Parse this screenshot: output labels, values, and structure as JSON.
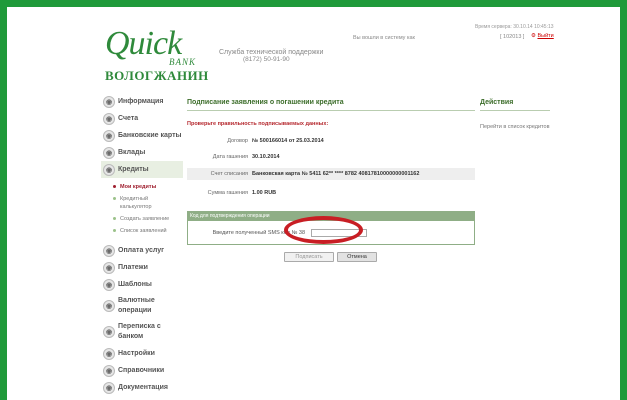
{
  "header": {
    "logo_quick": "Quick",
    "logo_bank": "BANK",
    "logo_vologzhanin": "ВОЛОГЖАНИН",
    "support_label": "Служба технической поддержки",
    "support_phone": "(8172) 50-91-90",
    "login_text": "Вы вошли в систему как",
    "session_info": "Время сервера: 30.10.14 10:45:13",
    "account": "[ 102013 ]",
    "exit_label": "Выйти"
  },
  "sidebar": {
    "items": [
      {
        "label": "Информация"
      },
      {
        "label": "Счета"
      },
      {
        "label": "Банковские карты"
      },
      {
        "label": "Вклады"
      },
      {
        "label": "Кредиты"
      },
      {
        "label": "Оплата услуг"
      },
      {
        "label": "Платежи"
      },
      {
        "label": "Шаблоны"
      },
      {
        "label": "Валютные операции"
      },
      {
        "label": "Переписка с банком"
      },
      {
        "label": "Настройки"
      },
      {
        "label": "Справочники"
      },
      {
        "label": "Документация"
      }
    ],
    "credit_subitems": [
      {
        "label": "Мои кредиты"
      },
      {
        "label": "Кредитный калькулятор"
      },
      {
        "label": "Создать заявление"
      },
      {
        "label": "Список заявлений"
      }
    ]
  },
  "main": {
    "title": "Подписание заявления о погашении кредита",
    "warning": "Проверьте правильность подписываемых данных:",
    "fields": [
      {
        "label": "Договор",
        "value": "№ 500166014 от 25.03.2014"
      },
      {
        "label": "Дата гашения",
        "value": "30.10.2014"
      },
      {
        "label": "Счет списания",
        "value": "Банковская карта № 5411 62** **** 8782 40817810000000001162"
      },
      {
        "label": "Сумма гашения",
        "value": "1.00 RUB"
      }
    ],
    "code_section_title": "Код для подтверждения операции",
    "code_label": "Введите полученный SMS код № 38",
    "code_value": "",
    "sign_button": "Подписать",
    "cancel_button": "Отмена"
  },
  "actions": {
    "title": "Действия",
    "link": "Перейти в список кредитов"
  }
}
